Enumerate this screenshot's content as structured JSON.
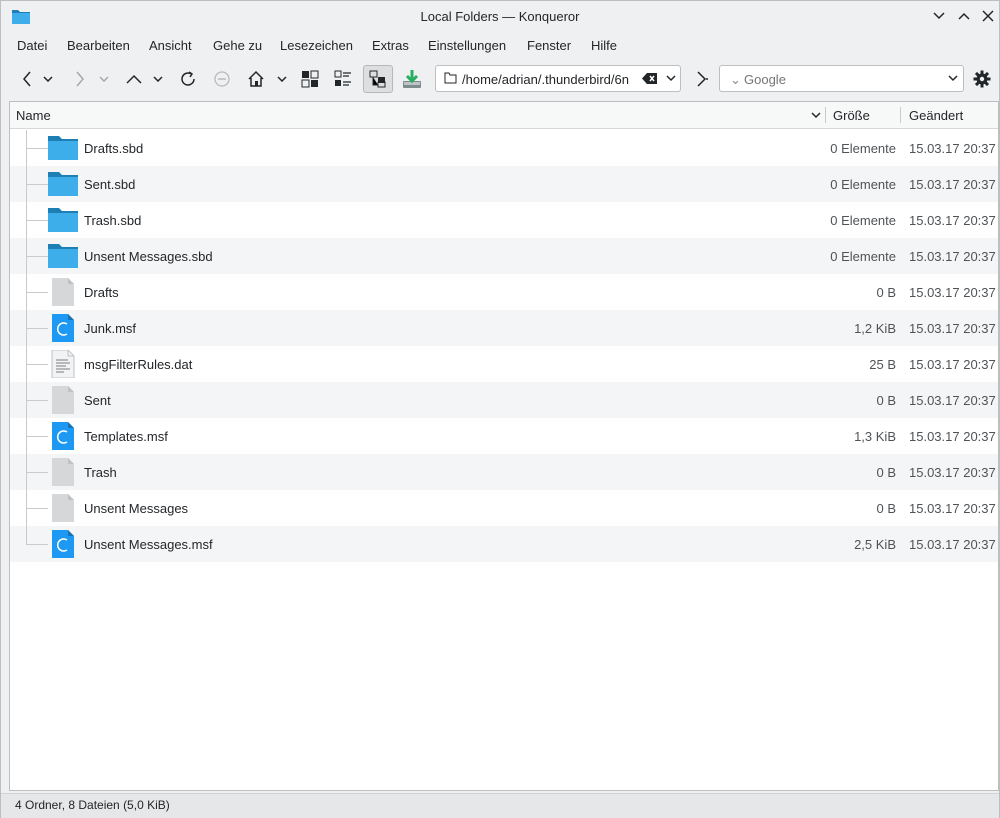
{
  "window": {
    "title": "Local Folders — Konqueror"
  },
  "menu": [
    {
      "label": "Datei"
    },
    {
      "label": "Bearbeiten"
    },
    {
      "label": "Ansicht"
    },
    {
      "label": "Gehe zu"
    },
    {
      "label": "Lesezeichen"
    },
    {
      "label": "Extras"
    },
    {
      "label": "Einstellungen"
    },
    {
      "label": "Fenster"
    },
    {
      "label": "Hilfe"
    }
  ],
  "address": {
    "value": "/home/adrian/.thunderbird/6n"
  },
  "search": {
    "placeholder": "Google"
  },
  "columns": {
    "name": "Name",
    "size": "Größe",
    "modified": "Geändert"
  },
  "rows": [
    {
      "name": "Drafts.sbd",
      "size": "0 Elemente",
      "date": "15.03.17 20:37",
      "icon": "folder-icon"
    },
    {
      "name": "Sent.sbd",
      "size": "0 Elemente",
      "date": "15.03.17 20:37",
      "icon": "folder-icon"
    },
    {
      "name": "Trash.sbd",
      "size": "0 Elemente",
      "date": "15.03.17 20:37",
      "icon": "folder-icon"
    },
    {
      "name": "Unsent Messages.sbd",
      "size": "0 Elemente",
      "date": "15.03.17 20:37",
      "icon": "folder-icon"
    },
    {
      "name": "Drafts",
      "size": "0 B",
      "date": "15.03.17 20:37",
      "icon": "blank-file-icon"
    },
    {
      "name": "Junk.msf",
      "size": "1,2 KiB",
      "date": "15.03.17 20:37",
      "icon": "msf-file-icon"
    },
    {
      "name": "msgFilterRules.dat",
      "size": "25 B",
      "date": "15.03.17 20:37",
      "icon": "text-file-icon"
    },
    {
      "name": "Sent",
      "size": "0 B",
      "date": "15.03.17 20:37",
      "icon": "blank-file-icon"
    },
    {
      "name": "Templates.msf",
      "size": "1,3 KiB",
      "date": "15.03.17 20:37",
      "icon": "msf-file-icon"
    },
    {
      "name": "Trash",
      "size": "0 B",
      "date": "15.03.17 20:37",
      "icon": "blank-file-icon"
    },
    {
      "name": "Unsent Messages",
      "size": "0 B",
      "date": "15.03.17 20:37",
      "icon": "blank-file-icon"
    },
    {
      "name": "Unsent Messages.msf",
      "size": "2,5 KiB",
      "date": "15.03.17 20:37",
      "icon": "msf-file-icon"
    }
  ],
  "status": {
    "text": "4 Ordner, 8 Dateien (5,0 KiB)"
  },
  "colors": {
    "folder": "#3daee9",
    "folder_tab": "#1d7fb3",
    "file": "#d6d7d8",
    "msf": "#1d99f3",
    "accent": "#3daee9"
  }
}
